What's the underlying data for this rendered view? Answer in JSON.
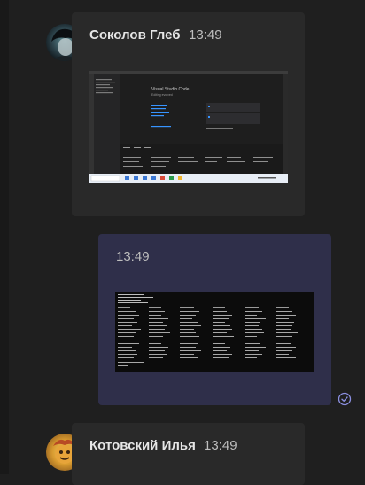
{
  "messages": [
    {
      "sender": "Соколов Глеб",
      "time": "13:49",
      "attachment": "vscode-screenshot",
      "attachment_title": "Visual Studio Code",
      "attachment_subtitle": "Editing evolved",
      "direction": "incoming"
    },
    {
      "sender": "",
      "time": "13:49",
      "attachment": "terminal-screenshot",
      "direction": "outgoing",
      "status": "read"
    },
    {
      "sender": "Котовский Илья",
      "time": "13:49",
      "direction": "incoming"
    }
  ],
  "colors": {
    "background": "#1f1f1f",
    "incoming_bubble": "#292929",
    "outgoing_bubble": "#2f2f4a",
    "read_receipt": "#8b8fe0"
  },
  "icons": {
    "read_receipt": "check-circle-icon"
  }
}
